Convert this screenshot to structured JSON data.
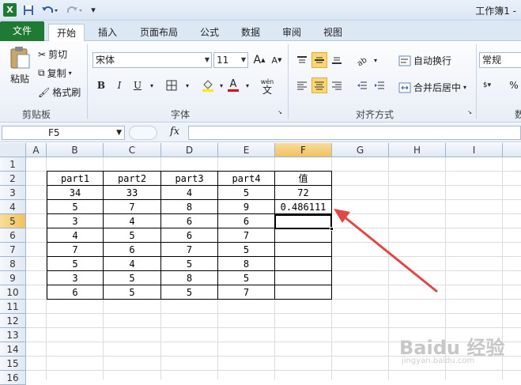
{
  "titlebar": {
    "title": "工作簿1 -",
    "undo_icon": "undo-icon",
    "redo_icon": "redo-icon"
  },
  "tabs": [
    "文件",
    "开始",
    "插入",
    "页面布局",
    "公式",
    "数据",
    "审阅",
    "视图"
  ],
  "ribbon": {
    "clipboard": {
      "paste": "粘贴",
      "cut": "剪切",
      "copy": "复制",
      "format_painter": "格式刷",
      "group": "剪贴板"
    },
    "font": {
      "name": "宋体",
      "size": "11",
      "group": "字体",
      "bold": "B",
      "italic": "I",
      "underline": "U",
      "grow": "A",
      "shrink": "A",
      "font_color_letter": "A",
      "phonetic_top": "wén",
      "phonetic_bottom": "文"
    },
    "alignment": {
      "wrap": "自动换行",
      "merge": "合并后居中",
      "group": "对齐方式"
    },
    "number": {
      "format": "常规",
      "percent": "%",
      "group": "数"
    }
  },
  "formula_bar": {
    "name_box": "F5",
    "fx": "fx",
    "content": ""
  },
  "columns": [
    "A",
    "B",
    "C",
    "D",
    "E",
    "F",
    "G",
    "H",
    "I"
  ],
  "selected_column": "F",
  "rows": [
    "1",
    "2",
    "3",
    "4",
    "5",
    "6",
    "7",
    "8",
    "9",
    "10",
    "11",
    "12",
    "13",
    "14",
    "15",
    "16"
  ],
  "selected_row": "5",
  "table": {
    "headers": [
      "part1",
      "part2",
      "part3",
      "part4",
      "值"
    ],
    "rows": [
      [
        "34",
        "33",
        "4",
        "5",
        "72"
      ],
      [
        "5",
        "7",
        "8",
        "9",
        "0.486111"
      ],
      [
        "3",
        "4",
        "6",
        "6",
        ""
      ],
      [
        "4",
        "5",
        "6",
        "7",
        ""
      ],
      [
        "7",
        "6",
        "7",
        "5",
        ""
      ],
      [
        "5",
        "4",
        "5",
        "8",
        ""
      ],
      [
        "3",
        "5",
        "8",
        "5",
        ""
      ],
      [
        "6",
        "5",
        "5",
        "7",
        ""
      ]
    ]
  },
  "annotation": {
    "color": "#e04848"
  },
  "watermark": {
    "main": "Baidu 经验",
    "sub": "jingyan.baidu.com"
  }
}
